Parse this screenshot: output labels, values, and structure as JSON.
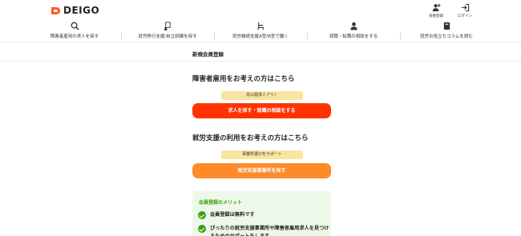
{
  "brand": {
    "name": "DEIGO",
    "accent": "#ff5a1f"
  },
  "header": {
    "actions": [
      {
        "label": "会員登録",
        "icon": "add-user-icon"
      },
      {
        "label": "ログイン",
        "icon": "login-icon"
      }
    ],
    "nav": [
      {
        "label": "障害者雇用の求人を探す",
        "icon": "search-icon"
      },
      {
        "label": "就労移行支援/自立訓練を探す",
        "icon": "training-icon"
      },
      {
        "label": "就労継続支援A型/B型で働く",
        "icon": "chair-icon"
      },
      {
        "label": "就職・転職の相談をする",
        "icon": "consult-icon"
      },
      {
        "label": "就労お役立ちコラムを読む",
        "icon": "book-icon"
      }
    ]
  },
  "page": {
    "title": "新規会員登録"
  },
  "sections": {
    "employment": {
      "title": "障害者雇用をお考えの方はこちら",
      "badge": "非公開求人アリ！",
      "button": "求人を探す・就職の相談をする"
    },
    "support": {
      "title": "就労支援の利用をお考えの方はこちら",
      "badge": "事業所選びをサポート",
      "button": "就労支援事業所を探す"
    }
  },
  "merit": {
    "title": "会員登録のメリット",
    "items": [
      "会員登録は無料です",
      "ぴったりの就労支援事業所や障害者雇用求人を見つけるためのサポートをします"
    ]
  },
  "colors": {
    "red_cta": "#ff3200",
    "orange_cta": "#ff8a2a",
    "badge": "#f8e5a0",
    "green": "#3aa012",
    "merit_bg": "#eef8e8"
  }
}
